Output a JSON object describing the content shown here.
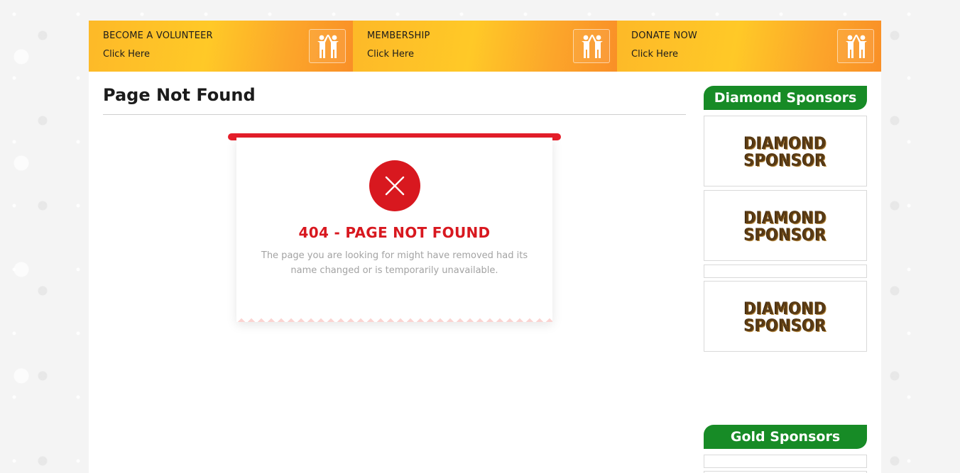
{
  "cta_bar": {
    "items": [
      {
        "title": "BECOME A VOLUNTEER",
        "subtitle": "Click Here",
        "icon": "people-high-five-icon"
      },
      {
        "title": "MEMBERSHIP",
        "subtitle": "Click Here",
        "icon": "people-high-five-icon"
      },
      {
        "title": "DONATE NOW",
        "subtitle": "Click Here",
        "icon": "people-high-five-icon"
      }
    ]
  },
  "main": {
    "page_title": "Page Not Found",
    "error": {
      "icon": "close-icon",
      "heading": "404 - PAGE NOT FOUND",
      "message": "The page you are looking for might have removed had its name changed or is temporarily unavailable."
    }
  },
  "sidebar": {
    "diamond": {
      "heading": "Diamond Sponsors",
      "sponsors": [
        {
          "line1": "DIAMOND",
          "line2": "SPONSOR"
        },
        {
          "line1": "DIAMOND",
          "line2": "SPONSOR"
        },
        {
          "line1": "DIAMOND",
          "line2": "SPONSOR"
        }
      ]
    },
    "gold": {
      "heading": "Gold Sponsors"
    }
  },
  "colors": {
    "cta_gradient_start": "#fdb928",
    "cta_gradient_end": "#f98f27",
    "error_red": "#d8181f",
    "top_bar_red": "#e51e2a",
    "sponsor_green": "#178b26",
    "muted_text": "#a3a3a3"
  }
}
